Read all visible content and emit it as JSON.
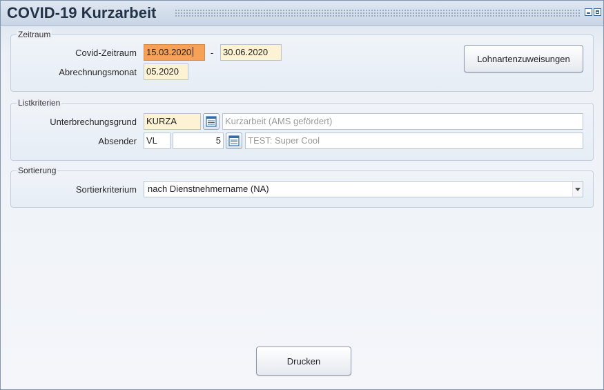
{
  "window": {
    "title": "COVID-19 Kurzarbeit"
  },
  "zeitraum": {
    "legend": "Zeitraum",
    "covid_label": "Covid-Zeitraum",
    "from": "15.03.2020",
    "separator": "-",
    "to": "30.06.2020",
    "abrechnung_label": "Abrechnungsmonat",
    "abrechnung_value": "05.2020",
    "lohnarten_button": "Lohnartenzuweisungen"
  },
  "listkriterien": {
    "legend": "Listkriterien",
    "unterbrechung_label": "Unterbrechungsgrund",
    "unterbrechung_code": "KURZA",
    "unterbrechung_desc": "Kurzarbeit (AMS gefördert)",
    "absender_label": "Absender",
    "absender_code": "VL",
    "absender_number": "5",
    "absender_desc": "TEST: Super Cool"
  },
  "sortierung": {
    "legend": "Sortierung",
    "kriterium_label": "Sortierkriterium",
    "kriterium_value": "nach Dienstnehmername (NA)"
  },
  "footer": {
    "print_button": "Drucken"
  },
  "icons": {
    "minimize": "minimize-icon",
    "maximize": "maximize-icon",
    "lookup": "calendar-list-icon",
    "dropdown": "chevron-down-icon"
  },
  "colors": {
    "active_field": "#f6a157",
    "required_field": "#fef2d4",
    "title_text": "#233347"
  }
}
